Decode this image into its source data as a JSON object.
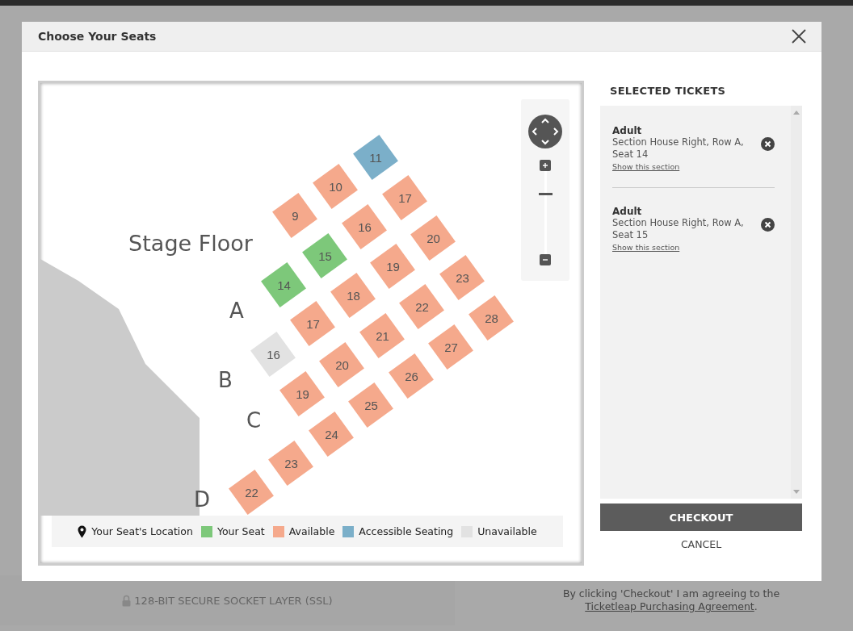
{
  "dialog": {
    "title": "Choose Your Seats",
    "map": {
      "section_label": "Stage Floor",
      "row_labels": [
        "A",
        "B",
        "C",
        "D"
      ],
      "seats": [
        {
          "number": "11",
          "color": "#7bafc9"
        },
        {
          "number": "10",
          "color": "#f5a98c"
        },
        {
          "number": "17",
          "color": "#f5a98c"
        },
        {
          "number": "9",
          "color": "#f5a98c"
        },
        {
          "number": "16",
          "color": "#f5a98c"
        },
        {
          "number": "20",
          "color": "#f5a98c"
        },
        {
          "number": "15",
          "color": "#7dc87a"
        },
        {
          "number": "19",
          "color": "#f5a98c"
        },
        {
          "number": "23",
          "color": "#f5a98c"
        },
        {
          "number": "14",
          "color": "#7dc87a"
        },
        {
          "number": "18",
          "color": "#f5a98c"
        },
        {
          "number": "22",
          "color": "#f5a98c"
        },
        {
          "number": "28",
          "color": "#f5a98c"
        },
        {
          "number": "17",
          "color": "#f5a98c"
        },
        {
          "number": "21",
          "color": "#f5a98c"
        },
        {
          "number": "27",
          "color": "#f5a98c"
        },
        {
          "number": "16",
          "color": "#e2e2e2"
        },
        {
          "number": "20",
          "color": "#f5a98c"
        },
        {
          "number": "26",
          "color": "#f5a98c"
        },
        {
          "number": "19",
          "color": "#f5a98c"
        },
        {
          "number": "25",
          "color": "#f5a98c"
        },
        {
          "number": "24",
          "color": "#f5a98c"
        },
        {
          "number": "23",
          "color": "#f5a98c"
        },
        {
          "number": "22",
          "color": "#f5a98c"
        }
      ],
      "zoom": {
        "level": 0.73
      },
      "legend": [
        {
          "kind": "location",
          "label": "Your Seat's Location"
        },
        {
          "kind": "swatch",
          "label": "Your Seat",
          "color": "#7dc87a"
        },
        {
          "kind": "swatch",
          "label": "Available",
          "color": "#f5a98c"
        },
        {
          "kind": "swatch",
          "label": "Accessible Seating",
          "color": "#7bafc9"
        },
        {
          "kind": "swatch",
          "label": "Unavailable",
          "color": "#e2e2e2"
        }
      ]
    },
    "tickets_heading": "SELECTED TICKETS",
    "tickets": [
      {
        "type": "Adult",
        "description": "Section House Right, Row A, Seat 14",
        "link": "Show this section"
      },
      {
        "type": "Adult",
        "description": "Section House Right, Row A, Seat 15",
        "link": "Show this section"
      }
    ],
    "checkout": "CHECKOUT",
    "cancel": "CANCEL"
  },
  "page_footer": {
    "security_note": "128-BIT SECURE SOCKET LAYER (SSL)",
    "agreement": {
      "text": "By clicking 'Checkout' I am agreeing to the ",
      "link": "Ticketleap Purchasing Agreement",
      "end": "."
    }
  }
}
